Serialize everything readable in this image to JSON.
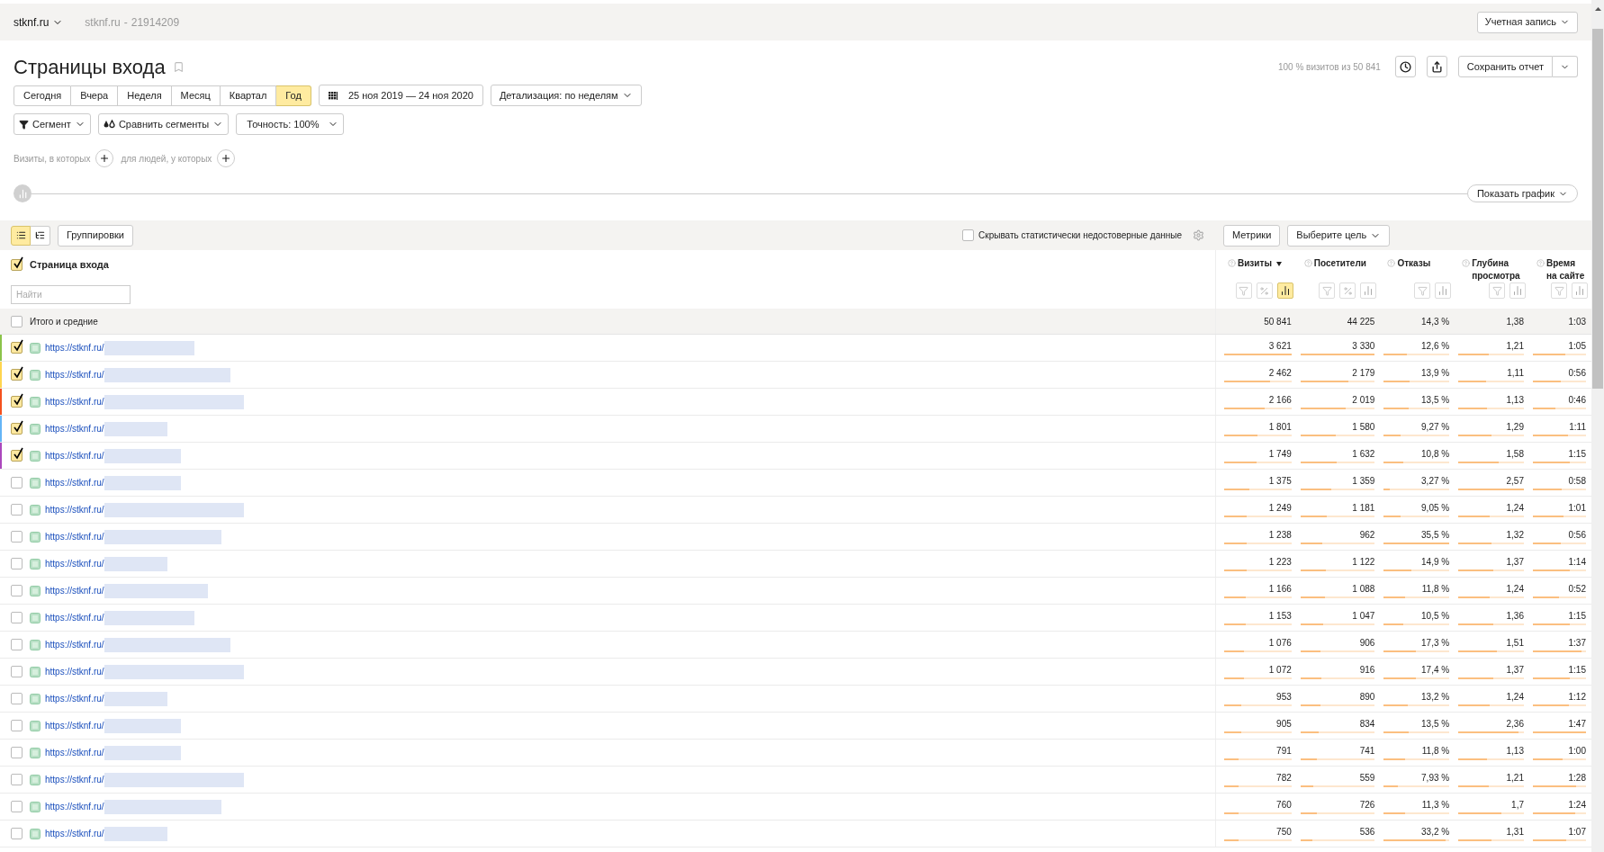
{
  "top_bar": {
    "site_selector": "stknf.ru",
    "counter_name": "stknf.ru",
    "counter_separator": "-",
    "counter_id": "21914209",
    "account_button": "Учетная запись"
  },
  "report": {
    "title": "Страницы входа",
    "sample_note": "100 % визитов из 50 841",
    "save_button": "Сохранить отчет"
  },
  "periods": [
    {
      "label": "Сегодня",
      "selected": false
    },
    {
      "label": "Вчера",
      "selected": false
    },
    {
      "label": "Неделя",
      "selected": false
    },
    {
      "label": "Месяц",
      "selected": false
    },
    {
      "label": "Квартал",
      "selected": false
    },
    {
      "label": "Год",
      "selected": true
    }
  ],
  "date_range": "25 ноя 2019 — 24 ноя 2020",
  "detail_dropdown": "Детализация: по неделям",
  "segment_buttons": [
    {
      "kind": "segment",
      "label": "Сегмент"
    },
    {
      "kind": "compare",
      "label": "Сравнить сегменты"
    },
    {
      "kind": "plain",
      "label": "Точность: 100%"
    }
  ],
  "conditions": [
    {
      "label": "Визиты, в которых"
    },
    {
      "label": "для людей, у которых"
    }
  ],
  "chart_toggle": "Показать график",
  "table_toolbar": {
    "views": [
      {
        "kind": "list",
        "selected": true
      },
      {
        "kind": "tree",
        "selected": false
      }
    ],
    "groupings_button": "Группировки",
    "hide_unreliable": {
      "label": "Скрывать статистически недостоверные данные",
      "checked": false
    },
    "metrics_button": "Метрики",
    "goal_dropdown": "Выберите цель"
  },
  "dimension": {
    "label": "Страница входа",
    "checked": true
  },
  "search": {
    "placeholder": "Найти"
  },
  "columns": [
    {
      "label": "Визиты",
      "sorted": true,
      "tools": [
        {
          "kind": "filter",
          "selected": false
        },
        {
          "kind": "percent",
          "selected": false
        },
        {
          "kind": "chart",
          "selected": true
        }
      ]
    },
    {
      "label": "Посетители",
      "sorted": false,
      "tools": [
        {
          "kind": "filter",
          "selected": false
        },
        {
          "kind": "percent",
          "selected": false
        },
        {
          "kind": "chart",
          "selected": false
        }
      ]
    },
    {
      "label": "Отказы",
      "sorted": false,
      "tools": [
        {
          "kind": "filter",
          "selected": false
        },
        {
          "kind": "chart",
          "selected": false
        }
      ]
    },
    {
      "label": "Глубина просмотра",
      "sorted": false,
      "tools": [
        {
          "kind": "filter",
          "selected": false
        },
        {
          "kind": "chart",
          "selected": false
        }
      ]
    },
    {
      "label": "Время на сайте",
      "sorted": false,
      "tools": [
        {
          "kind": "filter",
          "selected": false
        },
        {
          "kind": "chart",
          "selected": false
        }
      ]
    }
  ],
  "totals": {
    "label": "Итого и средние",
    "checked": false,
    "values": [
      "50 841",
      "44 225",
      "14,3 %",
      "1,38",
      "1:03"
    ]
  },
  "rows": [
    {
      "url": "https://stknf.ru/",
      "checked": true,
      "color": "#8bc34a",
      "cells": [
        {
          "value": "3 621",
          "level": 1
        },
        {
          "value": "3 330",
          "level": 1
        },
        {
          "value": "12,6 %",
          "level": 0.35
        },
        {
          "value": "1,21",
          "level": 0.47
        },
        {
          "value": "1:05",
          "level": 0.61
        }
      ]
    },
    {
      "url": "https://stknf.ru/",
      "checked": true,
      "color": "#ffd54f",
      "cells": [
        {
          "value": "2 462",
          "level": 0.68
        },
        {
          "value": "2 179",
          "level": 0.65
        },
        {
          "value": "13,9 %",
          "level": 0.39
        },
        {
          "value": "1,11",
          "level": 0.43
        },
        {
          "value": "0:56",
          "level": 0.52
        }
      ]
    },
    {
      "url": "https://stknf.ru/",
      "checked": true,
      "color": "#f4511e",
      "cells": [
        {
          "value": "2 166",
          "level": 0.6
        },
        {
          "value": "2 019",
          "level": 0.61
        },
        {
          "value": "13,5 %",
          "level": 0.38
        },
        {
          "value": "1,13",
          "level": 0.44
        },
        {
          "value": "0:46",
          "level": 0.43
        }
      ]
    },
    {
      "url": "https://stknf.ru/",
      "checked": true,
      "color": "#64b5f6",
      "cells": [
        {
          "value": "1 801",
          "level": 0.5
        },
        {
          "value": "1 580",
          "level": 0.47
        },
        {
          "value": "9,27 %",
          "level": 0.26
        },
        {
          "value": "1,29",
          "level": 0.5
        },
        {
          "value": "1:11",
          "level": 0.66
        }
      ]
    },
    {
      "url": "https://stknf.ru/",
      "checked": true,
      "color": "#ab47bc",
      "cells": [
        {
          "value": "1 749",
          "level": 0.48
        },
        {
          "value": "1 632",
          "level": 0.49
        },
        {
          "value": "10,8 %",
          "level": 0.3
        },
        {
          "value": "1,58",
          "level": 0.61
        },
        {
          "value": "1:15",
          "level": 0.7
        }
      ]
    },
    {
      "url": "https://stknf.ru/",
      "checked": false,
      "cells": [
        {
          "value": "1 375",
          "level": 0.38
        },
        {
          "value": "1 359",
          "level": 0.41
        },
        {
          "value": "3,27 %",
          "level": 0.09
        },
        {
          "value": "2,57",
          "level": 1
        },
        {
          "value": "0:58",
          "level": 0.54
        }
      ]
    },
    {
      "url": "https://stknf.ru/",
      "checked": false,
      "cells": [
        {
          "value": "1 249",
          "level": 0.34
        },
        {
          "value": "1 181",
          "level": 0.35
        },
        {
          "value": "9,05 %",
          "level": 0.25
        },
        {
          "value": "1,24",
          "level": 0.48
        },
        {
          "value": "1:01",
          "level": 0.57
        }
      ]
    },
    {
      "url": "https://stknf.ru/",
      "checked": false,
      "cells": [
        {
          "value": "1 238",
          "level": 0.34
        },
        {
          "value": "962",
          "level": 0.29
        },
        {
          "value": "35,5 %",
          "level": 1
        },
        {
          "value": "1,32",
          "level": 0.51
        },
        {
          "value": "0:56",
          "level": 0.52
        }
      ]
    },
    {
      "url": "https://stknf.ru/",
      "checked": false,
      "cells": [
        {
          "value": "1 223",
          "level": 0.34
        },
        {
          "value": "1 122",
          "level": 0.34
        },
        {
          "value": "14,9 %",
          "level": 0.42
        },
        {
          "value": "1,37",
          "level": 0.53
        },
        {
          "value": "1:14",
          "level": 0.69
        }
      ]
    },
    {
      "url": "https://stknf.ru/",
      "checked": false,
      "cells": [
        {
          "value": "1 166",
          "level": 0.32
        },
        {
          "value": "1 088",
          "level": 0.33
        },
        {
          "value": "11,8 %",
          "level": 0.33
        },
        {
          "value": "1,24",
          "level": 0.48
        },
        {
          "value": "0:52",
          "level": 0.49
        }
      ]
    },
    {
      "url": "https://stknf.ru/",
      "checked": false,
      "cells": [
        {
          "value": "1 153",
          "level": 0.32
        },
        {
          "value": "1 047",
          "level": 0.31
        },
        {
          "value": "10,5 %",
          "level": 0.3
        },
        {
          "value": "1,36",
          "level": 0.53
        },
        {
          "value": "1:15",
          "level": 0.7
        }
      ]
    },
    {
      "url": "https://stknf.ru/",
      "checked": false,
      "cells": [
        {
          "value": "1 076",
          "level": 0.3
        },
        {
          "value": "906",
          "level": 0.27
        },
        {
          "value": "17,3 %",
          "level": 0.49
        },
        {
          "value": "1,51",
          "level": 0.59
        },
        {
          "value": "1:37",
          "level": 0.91
        }
      ]
    },
    {
      "url": "https://stknf.ru/",
      "checked": false,
      "cells": [
        {
          "value": "1 072",
          "level": 0.3
        },
        {
          "value": "916",
          "level": 0.28
        },
        {
          "value": "17,4 %",
          "level": 0.49
        },
        {
          "value": "1,37",
          "level": 0.53
        },
        {
          "value": "1:15",
          "level": 0.7
        }
      ]
    },
    {
      "url": "https://stknf.ru/",
      "checked": false,
      "cells": [
        {
          "value": "953",
          "level": 0.26
        },
        {
          "value": "890",
          "level": 0.27
        },
        {
          "value": "13,2 %",
          "level": 0.37
        },
        {
          "value": "1,24",
          "level": 0.48
        },
        {
          "value": "1:12",
          "level": 0.67
        }
      ]
    },
    {
      "url": "https://stknf.ru/",
      "checked": false,
      "cells": [
        {
          "value": "905",
          "level": 0.25
        },
        {
          "value": "834",
          "level": 0.25
        },
        {
          "value": "13,5 %",
          "level": 0.38
        },
        {
          "value": "2,36",
          "level": 0.92
        },
        {
          "value": "1:47",
          "level": 1
        }
      ]
    },
    {
      "url": "https://stknf.ru/",
      "checked": false,
      "cells": [
        {
          "value": "791",
          "level": 0.22
        },
        {
          "value": "741",
          "level": 0.22
        },
        {
          "value": "11,8 %",
          "level": 0.33
        },
        {
          "value": "1,13",
          "level": 0.44
        },
        {
          "value": "1:00",
          "level": 0.56
        }
      ]
    },
    {
      "url": "https://stknf.ru/",
      "checked": false,
      "cells": [
        {
          "value": "782",
          "level": 0.22
        },
        {
          "value": "559",
          "level": 0.17
        },
        {
          "value": "7,93 %",
          "level": 0.22
        },
        {
          "value": "1,21",
          "level": 0.47
        },
        {
          "value": "1:28",
          "level": 0.82
        }
      ]
    },
    {
      "url": "https://stknf.ru/",
      "checked": false,
      "cells": [
        {
          "value": "760",
          "level": 0.21
        },
        {
          "value": "726",
          "level": 0.22
        },
        {
          "value": "11,3 %",
          "level": 0.32
        },
        {
          "value": "1,7",
          "level": 0.66
        },
        {
          "value": "1:24",
          "level": 0.79
        }
      ]
    },
    {
      "url": "https://stknf.ru/",
      "checked": false,
      "cells": [
        {
          "value": "750",
          "level": 0.21
        },
        {
          "value": "536",
          "level": 0.16
        },
        {
          "value": "33,2 %",
          "level": 0.94
        },
        {
          "value": "1,31",
          "level": 0.51
        },
        {
          "value": "1:07",
          "level": 0.63
        }
      ]
    }
  ]
}
